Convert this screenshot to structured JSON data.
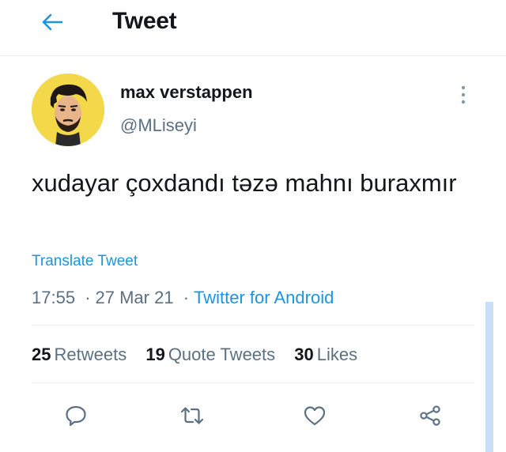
{
  "header": {
    "title": "Tweet",
    "back_icon": "arrow-left-icon"
  },
  "author": {
    "name": "max verstappen",
    "handle": "@MLiseyi",
    "avatar_icon": "avatar-portrait"
  },
  "tweet": {
    "text": "xudayar çoxdandı təzə mahnı buraxmır",
    "translate_label": "Translate Tweet",
    "time": "17:55",
    "separator": "·",
    "date": "27 Mar 21",
    "source": "Twitter for Android"
  },
  "stats": {
    "retweets_count": "25",
    "retweets_label": "Retweets",
    "quotes_count": "19",
    "quotes_label": "Quote Tweets",
    "likes_count": "30",
    "likes_label": "Likes"
  },
  "actions": {
    "reply_icon": "reply-icon",
    "retweet_icon": "retweet-icon",
    "like_icon": "heart-icon",
    "share_icon": "share-icon"
  },
  "colors": {
    "accent": "#1b95e0",
    "secondary_text": "#5b7083",
    "divider": "#e6ecf0",
    "avatar_background": "#f3d84a"
  }
}
